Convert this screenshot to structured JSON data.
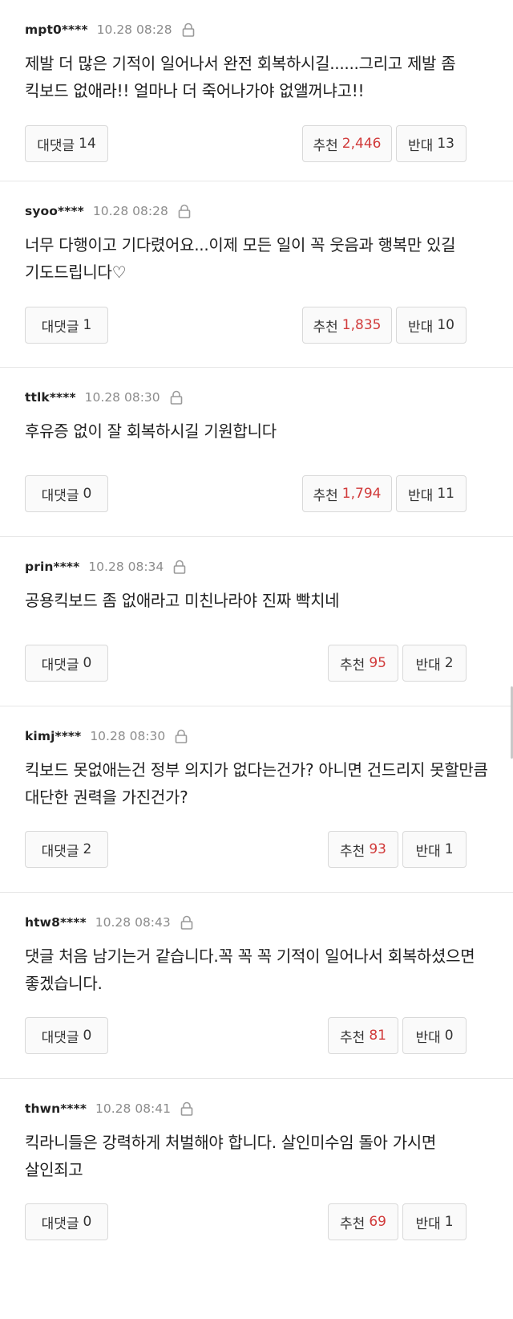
{
  "labels": {
    "reply": "대댓글",
    "like": "추천",
    "dislike": "반대"
  },
  "colors": {
    "like_count": "#d13b3b",
    "meta_time": "#8c8c8c",
    "divider": "#e6e6e6"
  },
  "icons": {
    "meta": "lock-icon"
  },
  "comments": [
    {
      "user": "mpt0****",
      "time": "10.28 08:28",
      "body": "제발 더 많은 기적이 일어나서 완전 회복하시길......그리고 제발 좀 킥보드 없애라!! 얼마나 더 죽어나가야 없앨꺼냐고!!",
      "replies": "14",
      "likes": "2,446",
      "dislikes": "13"
    },
    {
      "user": "syoo****",
      "time": "10.28 08:28",
      "body": "너무 다행이고 기다렸어요...이제 모든 일이 꼭 웃음과 행복만 있길 기도드립니다♡",
      "replies": "1",
      "likes": "1,835",
      "dislikes": "10"
    },
    {
      "user": "ttlk****",
      "time": "10.28 08:30",
      "body": "후유증 없이 잘 회복하시길 기원합니다",
      "replies": "0",
      "likes": "1,794",
      "dislikes": "11"
    },
    {
      "user": "prin****",
      "time": "10.28 08:34",
      "body": "공용킥보드 좀 없애라고 미친나라야 진짜 빡치네",
      "replies": "0",
      "likes": "95",
      "dislikes": "2"
    },
    {
      "user": "kimj****",
      "time": "10.28 08:30",
      "body": "킥보드 못없애는건 정부 의지가 없다는건가? 아니면 건드리지 못할만큼 대단한 권력을 가진건가?",
      "replies": "2",
      "likes": "93",
      "dislikes": "1"
    },
    {
      "user": "htw8****",
      "time": "10.28 08:43",
      "body": "댓글 처음 남기는거 같습니다.꼭 꼭 꼭 기적이 일어나서 회복하셨으면 좋겠습니다.",
      "replies": "0",
      "likes": "81",
      "dislikes": "0"
    },
    {
      "user": "thwn****",
      "time": "10.28 08:41",
      "body": "킥라니들은 강력하게 처벌해야 합니다. 살인미수임 돌아 가시면 살인죄고",
      "replies": "0",
      "likes": "69",
      "dislikes": "1"
    }
  ]
}
